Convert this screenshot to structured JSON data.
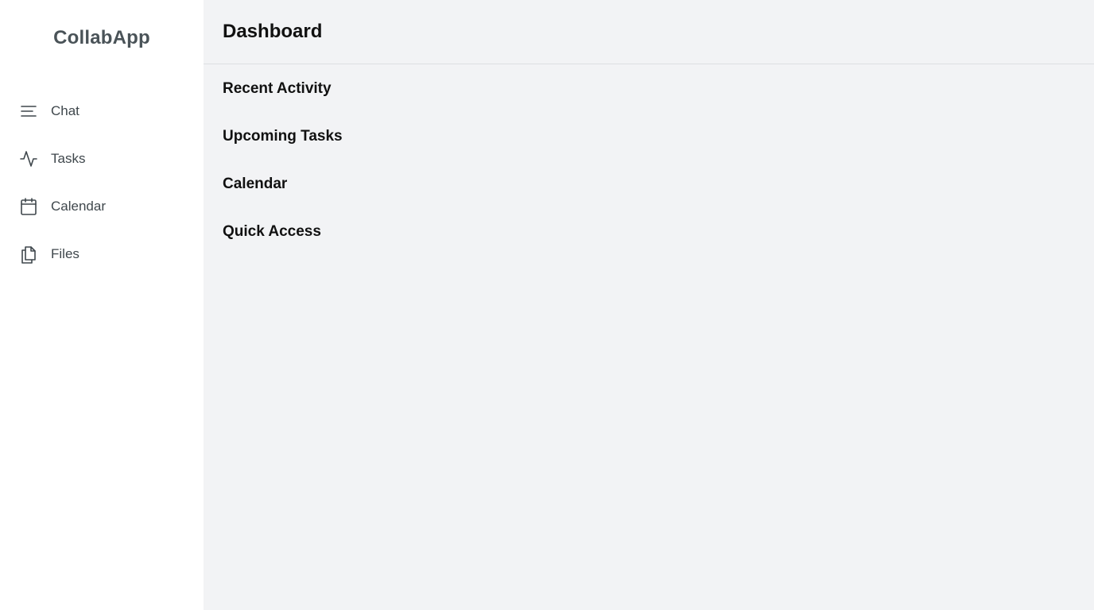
{
  "app": {
    "brand": "CollabApp"
  },
  "sidebar": {
    "items": [
      {
        "label": "Chat",
        "icon": "menu-lines-icon"
      },
      {
        "label": "Tasks",
        "icon": "activity-icon"
      },
      {
        "label": "Calendar",
        "icon": "calendar-icon"
      },
      {
        "label": "Files",
        "icon": "files-icon"
      }
    ]
  },
  "header": {
    "title": "Dashboard"
  },
  "main": {
    "sections": [
      {
        "title": "Recent Activity"
      },
      {
        "title": "Upcoming Tasks"
      },
      {
        "title": "Calendar"
      },
      {
        "title": "Quick Access"
      }
    ]
  },
  "colors": {
    "sidebar_bg": "#ffffff",
    "main_bg": "#f2f3f5",
    "brand_text": "#4a5358",
    "nav_text": "#3f474c",
    "heading_text": "#111111",
    "divider": "#dcdfe2"
  }
}
